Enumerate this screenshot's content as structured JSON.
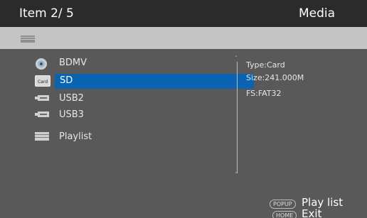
{
  "header": {
    "position": "Item 2/ 5",
    "source": "Media"
  },
  "path_icon": "folder-icon",
  "items": [
    {
      "label": "BDMV",
      "icon": "disc-icon"
    },
    {
      "label": "SD",
      "icon": "card-icon",
      "icon_text": "Card"
    },
    {
      "label": "USB2",
      "icon": "usb-icon"
    },
    {
      "label": "USB3",
      "icon": "usb-icon"
    },
    {
      "label": "Playlist",
      "icon": "folder-icon"
    }
  ],
  "selected_index": 1,
  "info": {
    "type": "Type:Card",
    "size": "Size:241.000M",
    "fs": "FS:FAT32"
  },
  "hints": [
    {
      "key": "POPUP",
      "action": "Play list"
    },
    {
      "key": "HOME",
      "action": "Exit"
    }
  ],
  "colors": {
    "background": "#595959",
    "header": "#2b2b2b",
    "path_bar": "#c4c4c4",
    "selection": "#0a63b0"
  }
}
